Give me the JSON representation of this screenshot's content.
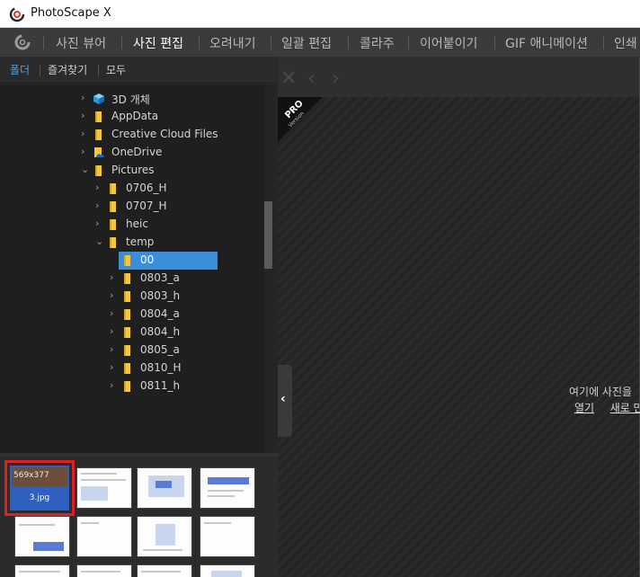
{
  "window": {
    "title": "PhotoScape X"
  },
  "menu": {
    "items": [
      "사진 뷰어",
      "사진 편집",
      "오려내기",
      "일괄 편집",
      "콜라주",
      "이어붙이기",
      "GIF 애니메이션",
      "인쇄"
    ],
    "active_index": 1
  },
  "subtabs": [
    "폴더",
    "즐겨찾기",
    "모두"
  ],
  "tree": [
    {
      "label": "3D 개체",
      "icon": "cube-icon",
      "expanded": false
    },
    {
      "label": "AppData",
      "icon": "folder-icon",
      "expanded": false
    },
    {
      "label": "Creative Cloud Files",
      "icon": "folder-icon",
      "expanded": false
    },
    {
      "label": "OneDrive",
      "icon": "onedrive-folder-icon",
      "expanded": false
    },
    {
      "label": "Pictures",
      "icon": "folder-icon",
      "expanded": true
    },
    {
      "label": "0706_H",
      "icon": "folder-icon",
      "expanded": false
    },
    {
      "label": "0707_H",
      "icon": "folder-icon",
      "expanded": false
    },
    {
      "label": "heic",
      "icon": "folder-icon",
      "expanded": false
    },
    {
      "label": "temp",
      "icon": "folder-icon",
      "expanded": true
    },
    {
      "label": "00",
      "icon": "folder-icon",
      "selected": true
    },
    {
      "label": "0803_a",
      "icon": "folder-icon",
      "expanded": false
    },
    {
      "label": "0803_h",
      "icon": "folder-icon",
      "expanded": false
    },
    {
      "label": "0804_a",
      "icon": "folder-icon",
      "expanded": false
    },
    {
      "label": "0804_h",
      "icon": "folder-icon",
      "expanded": false
    },
    {
      "label": "0805_a",
      "icon": "folder-icon",
      "expanded": false
    },
    {
      "label": "0810_H",
      "icon": "folder-icon",
      "expanded": false
    },
    {
      "label": "0811_h",
      "icon": "folder-icon",
      "expanded": false
    }
  ],
  "thumbnails": {
    "selected": {
      "dimensions": "569x377",
      "filename": "3.jpg"
    }
  },
  "canvas": {
    "pro_badge_top": "PRO",
    "pro_badge_bottom": "Version",
    "hint_line1": "여기에 사진을",
    "hint_link1": "열기",
    "hint_link2": "새로 만"
  },
  "colors": {
    "accent": "#3a8fd8",
    "highlight": "#e02020",
    "folder": "#f3c640"
  }
}
